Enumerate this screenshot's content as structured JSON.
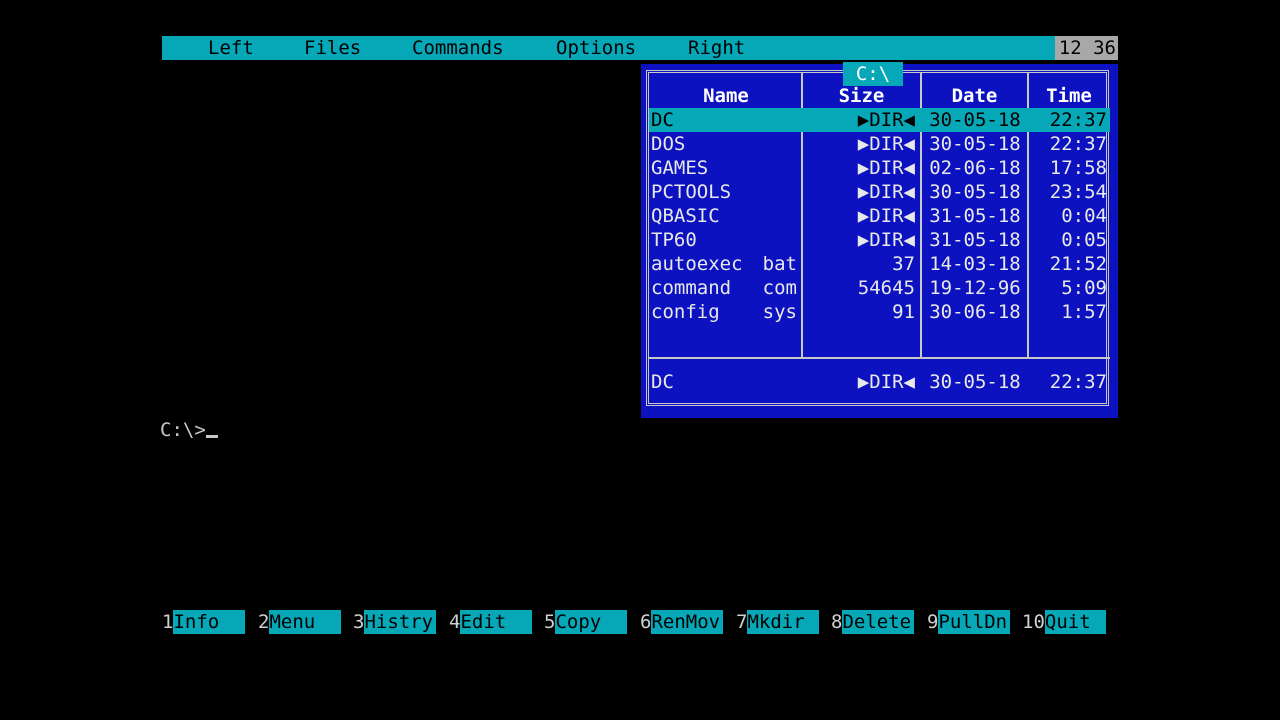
{
  "menubar": {
    "items": [
      "Left",
      "Files",
      "Commands",
      "Options",
      "Right"
    ],
    "clock": "12 36"
  },
  "panel": {
    "path": "C:\\",
    "columns": [
      "Name",
      "Size",
      "Date",
      "Time"
    ],
    "files": [
      {
        "name": "DC",
        "ext": "",
        "size": "▶DIR◀",
        "date": "30-05-18",
        "time": "22:37"
      },
      {
        "name": "DOS",
        "ext": "",
        "size": "▶DIR◀",
        "date": "30-05-18",
        "time": "22:37"
      },
      {
        "name": "GAMES",
        "ext": "",
        "size": "▶DIR◀",
        "date": "02-06-18",
        "time": "17:58"
      },
      {
        "name": "PCTOOLS",
        "ext": "",
        "size": "▶DIR◀",
        "date": "30-05-18",
        "time": "23:54"
      },
      {
        "name": "QBASIC",
        "ext": "",
        "size": "▶DIR◀",
        "date": "31-05-18",
        "time": "0:04"
      },
      {
        "name": "TP60",
        "ext": "",
        "size": "▶DIR◀",
        "date": "31-05-18",
        "time": "0:05"
      },
      {
        "name": "autoexec",
        "ext": "bat",
        "size": "37",
        "date": "14-03-18",
        "time": "21:52"
      },
      {
        "name": "command",
        "ext": "com",
        "size": "54645",
        "date": "19-12-96",
        "time": "5:09"
      },
      {
        "name": "config",
        "ext": "sys",
        "size": "91",
        "date": "30-06-18",
        "time": "1:57"
      }
    ],
    "selected_index": 0,
    "status": {
      "name": "DC",
      "size": "▶DIR◀",
      "date": "30-05-18",
      "time": "22:37"
    }
  },
  "prompt": {
    "text": "C:\\>"
  },
  "fkeys": [
    {
      "num": "1",
      "label": "Info"
    },
    {
      "num": "2",
      "label": "Menu"
    },
    {
      "num": "3",
      "label": "Histry"
    },
    {
      "num": "4",
      "label": "Edit"
    },
    {
      "num": "5",
      "label": "Copy"
    },
    {
      "num": "6",
      "label": "RenMov"
    },
    {
      "num": "7",
      "label": "Mkdir"
    },
    {
      "num": "8",
      "label": "Delete"
    },
    {
      "num": "9",
      "label": "PullDn"
    },
    {
      "num": "10",
      "label": "Quit"
    }
  ],
  "colors": {
    "menu_bg": "#06a8b8",
    "panel_bg": "#0c12c0",
    "panel_text": "#e8e8e8",
    "screen_bg": "#000000"
  }
}
